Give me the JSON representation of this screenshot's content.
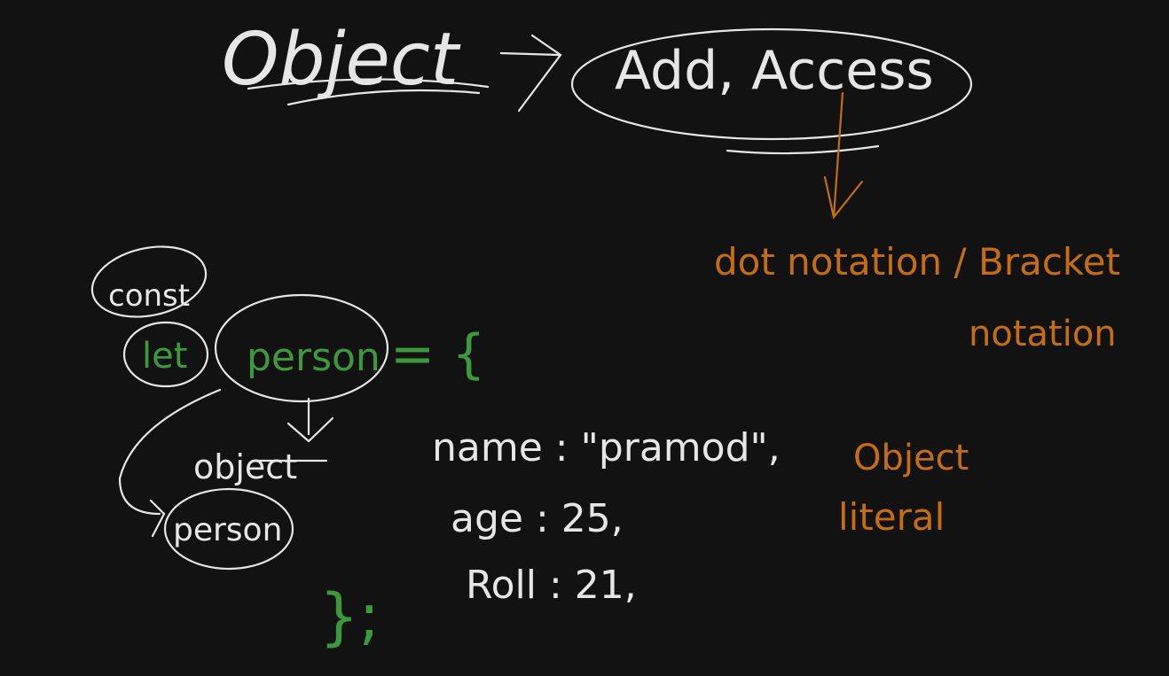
{
  "colors": {
    "background": "#121212",
    "ink_white": "#e6e6e6",
    "ink_green": "#3c9a3c",
    "ink_orange": "#c46d12"
  },
  "title": {
    "word": "Object",
    "arrow_target": "Add, Access"
  },
  "notations": {
    "line1": "dot notation / Bracket",
    "line2": "notation"
  },
  "declaration": {
    "const": "const",
    "let": "let",
    "name": "person",
    "equals": "= {",
    "close": "};"
  },
  "explanation": {
    "type_label": "object",
    "ref_name": "person"
  },
  "properties": [
    {
      "text": "name : \"pramod\","
    },
    {
      "text": "age : 25,"
    },
    {
      "text": "Roll : 21,"
    }
  ],
  "object_literal": {
    "line1": "Object",
    "line2": "literal"
  }
}
